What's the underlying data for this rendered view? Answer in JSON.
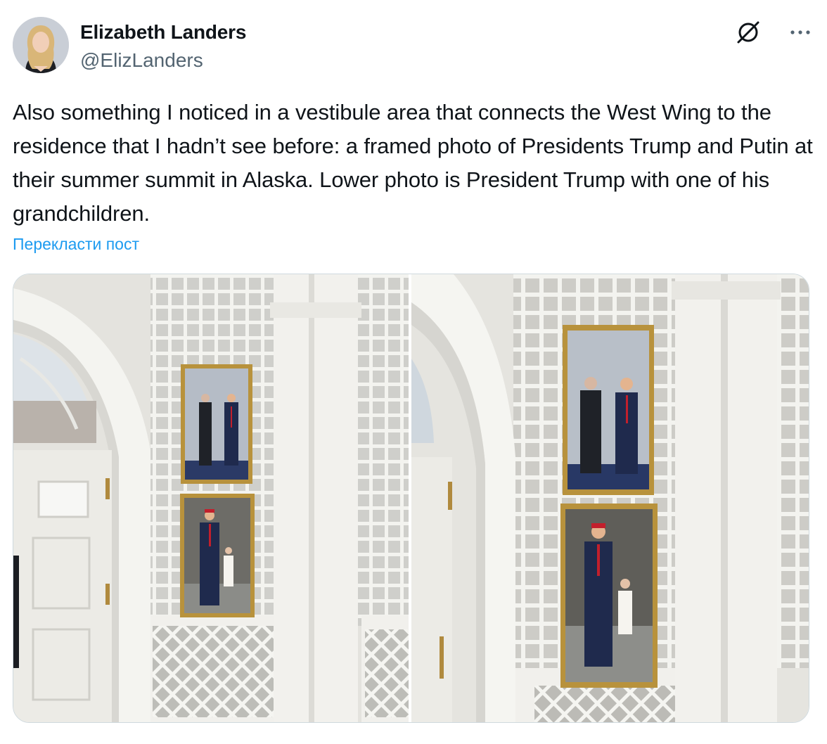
{
  "author": {
    "name": "Elizabeth Landers",
    "handle": "@ElizLanders"
  },
  "tweet": {
    "text": "Also something I noticed in a vestibule area that connects the West Wing to the residence that I hadn’t see before: a framed photo of Presidents Trump and Putin at their summer summit in Alaska. Lower photo is President Trump with one of his grandchildren.",
    "translate_label": "Перекласти пост"
  },
  "icons": {
    "grok": "grok-icon",
    "more": "more-horizontal-icon"
  },
  "colors": {
    "link": "#1d9bf0",
    "secondary_text": "#536471",
    "border": "#cfd9de"
  }
}
